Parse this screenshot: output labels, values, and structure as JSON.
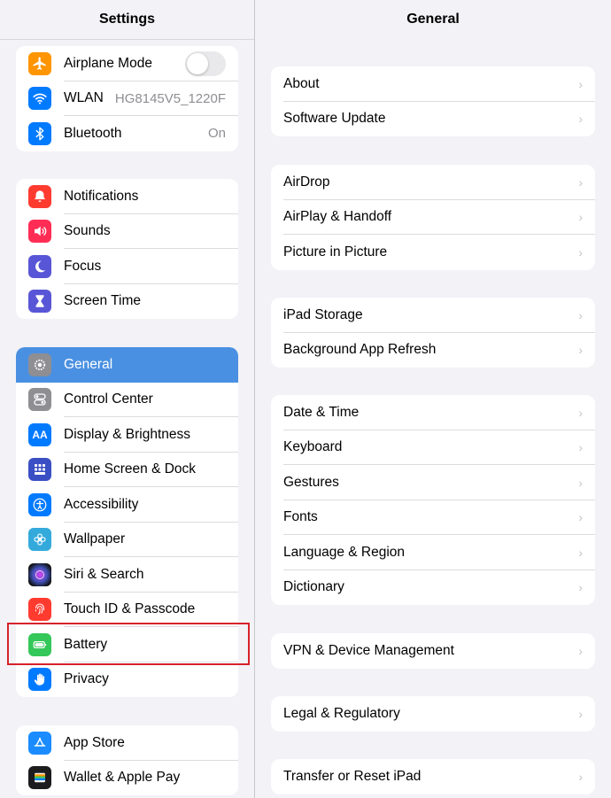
{
  "sidebar": {
    "title": "Settings",
    "group1": [
      {
        "label": "Airplane Mode",
        "icon": "airplane-icon",
        "color": "#ff9500",
        "toggle": "off"
      },
      {
        "label": "WLAN",
        "icon": "wifi-icon",
        "color": "#007aff",
        "value": "HG8145V5_1220F"
      },
      {
        "label": "Bluetooth",
        "icon": "bluetooth-icon",
        "color": "#007aff",
        "value": "On"
      }
    ],
    "group2": [
      {
        "label": "Notifications",
        "icon": "bell-icon",
        "color": "#ff3b30"
      },
      {
        "label": "Sounds",
        "icon": "speaker-icon",
        "color": "#ff2d55"
      },
      {
        "label": "Focus",
        "icon": "moon-icon",
        "color": "#5856d6"
      },
      {
        "label": "Screen Time",
        "icon": "hourglass-icon",
        "color": "#5856d6"
      }
    ],
    "group3": [
      {
        "label": "General",
        "icon": "gear-icon",
        "color": "#8e8e93",
        "selected": true
      },
      {
        "label": "Control Center",
        "icon": "switches-icon",
        "color": "#8e8e93"
      },
      {
        "label": "Display & Brightness",
        "icon": "text-size-icon",
        "color": "#007aff"
      },
      {
        "label": "Home Screen & Dock",
        "icon": "grid-icon",
        "color": "#3a4fc4"
      },
      {
        "label": "Accessibility",
        "icon": "accessibility-icon",
        "color": "#007aff"
      },
      {
        "label": "Wallpaper",
        "icon": "flower-icon",
        "color": "#34aadc"
      },
      {
        "label": "Siri & Search",
        "icon": "siri-icon",
        "color": "#222222"
      },
      {
        "label": "Touch ID & Passcode",
        "icon": "fingerprint-icon",
        "color": "#ff3b30"
      },
      {
        "label": "Battery",
        "icon": "battery-icon",
        "color": "#34c759"
      },
      {
        "label": "Privacy",
        "icon": "hand-icon",
        "color": "#007aff"
      }
    ],
    "group4": [
      {
        "label": "App Store",
        "icon": "app-store-icon",
        "color": "#1a8cff"
      },
      {
        "label": "Wallet & Apple Pay",
        "icon": "wallet-icon",
        "color": "#1c1c1e"
      }
    ]
  },
  "detail": {
    "title": "General",
    "groups": [
      [
        "About",
        "Software Update"
      ],
      [
        "AirDrop",
        "AirPlay & Handoff",
        "Picture in Picture"
      ],
      [
        "iPad Storage",
        "Background App Refresh"
      ],
      [
        "Date & Time",
        "Keyboard",
        "Gestures",
        "Fonts",
        "Language & Region",
        "Dictionary"
      ],
      [
        "VPN & Device Management"
      ],
      [
        "Legal & Regulatory"
      ],
      [
        "Transfer or Reset iPad"
      ]
    ]
  },
  "chevron": "›"
}
